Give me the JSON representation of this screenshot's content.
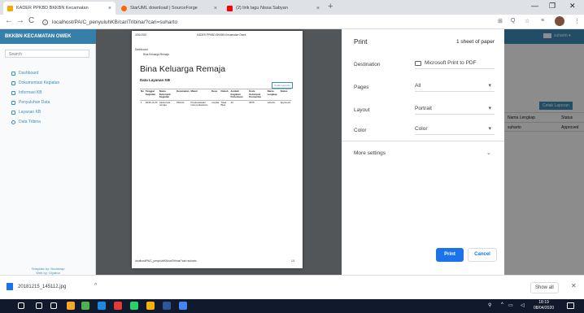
{
  "browser": {
    "tabs": [
      {
        "title": "KADER PPKBD BKKBN Kecamatan",
        "close": "×",
        "color": "#f6a800"
      },
      {
        "title": "StarUML download | SourceForge",
        "close": "×",
        "color": "#ff6600"
      },
      {
        "title": "(2) lirik lagu Nissa Sabyan",
        "close": "×",
        "color": "#ff0000"
      }
    ],
    "new_tab": "+",
    "window_controls": [
      "—",
      "❐",
      "✕"
    ],
    "nav": {
      "back": "←",
      "forward": "→",
      "reload": "C"
    },
    "url": "localhost/PA/C_penyuluhKB/cariTribina/?cari=suharto",
    "toolbar_icons": [
      "⊞",
      "Q",
      "☆",
      "≡",
      "⋮"
    ]
  },
  "page": {
    "brand": "BKKBN KECAMATAN OWEK",
    "user": "suharto ▾",
    "search_placeholder": "Search",
    "sidebar_items": [
      "Dashboard",
      "Dokumentasi Kegiatan",
      "Informasi KB",
      "Penyuluhan Data",
      "Layanan KB",
      "Data Tribina"
    ],
    "sidebar_footer": [
      "Template by: Bootstrap",
      "Web by: Giyatna"
    ],
    "cetak_label": "Cetak Laporan",
    "table_head": [
      "Nama Lengkap",
      "Status"
    ],
    "table_row": [
      "suharto",
      "Approved"
    ]
  },
  "print_preview": {
    "header_left": "3/26/2020",
    "header_center": "KADER PPKBD BKKBN Kecamatan Owek",
    "breadcrumb_top": "Dashboard",
    "breadcrumb_item": "Bina Keluarga Remaja",
    "title": "Bina Keluarga Remaja",
    "subtitle": "Data Layanan KB",
    "cetak": "Cetak Laporan",
    "columns": [
      "No",
      "Tanggal Kegiatan",
      "Nama Kelompok Kegiatan",
      "Kecamatan",
      "Materi",
      "Desa",
      "Dukuh",
      "Jumlah Kegiatan Pertemuan",
      "Kode Kelompok Komunitas",
      "Nama Lengkap",
      "Status"
    ],
    "row": [
      "1",
      "2018-11-20",
      "Asistensia remaja",
      "PRAJA",
      "Pendewasaan usia perkawinan",
      "mojolar",
      "Tawa Bias",
      "40",
      "8978",
      "suharto",
      "Approved"
    ],
    "footer_left": "localhost/PA/C_penyuluhKB/cariTribina/?cari=suharto",
    "footer_right": "1/1"
  },
  "print_settings": {
    "title": "Print",
    "sheets": "1 sheet of paper",
    "destination_label": "Destination",
    "destination_value": "Microsoft Print to PDF",
    "pages_label": "Pages",
    "pages_value": "All",
    "layout_label": "Layout",
    "layout_value": "Portrait",
    "color_label": "Color",
    "color_value": "Color",
    "more_settings": "More settings",
    "print_button": "Print",
    "cancel_button": "Cancel"
  },
  "downloads": {
    "file": "20181215_145112.jpg",
    "chevron": "^",
    "show_all": "Show all",
    "close": "✕"
  },
  "taskbar": {
    "time": "18:19",
    "date": "08/04/2020",
    "icon_colors": [
      "#ffffff",
      "#ffffff",
      "#ffffff",
      "#f9a825",
      "#4caf50",
      "#1e88e5",
      "#e53935",
      "#25d366",
      "#f4b400",
      "#2b579a",
      "#4285f4"
    ]
  }
}
